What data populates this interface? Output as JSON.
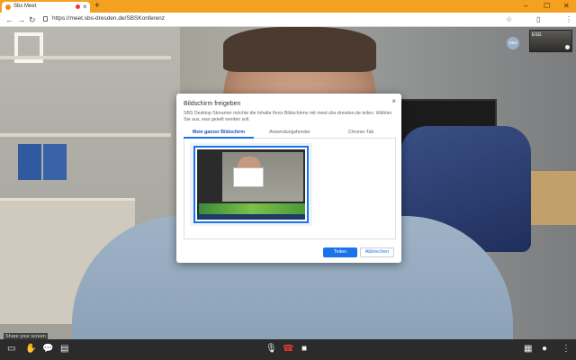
{
  "browser": {
    "tab_title": "Sbs Meet",
    "tab_close": "×",
    "new_tab": "+",
    "url": "https://meet.sbs-dresden.de/SBSKonferenz",
    "win_min": "–",
    "win_max": "☐",
    "win_close": "✕",
    "back": "←",
    "forward": "→",
    "reload": "↻",
    "star": "☆",
    "extensions": "⋮"
  },
  "meeting": {
    "self_label": "ESG",
    "avatar_initials": "SBS"
  },
  "dialog": {
    "title": "Bildschirm freigeben",
    "close": "×",
    "description": "SBS Desktop Streamer möchte die Inhalte Ihres Bildschirms mit meet.sbs-dresden.de teilen. Wählen Sie aus, was geteilt werden soll.",
    "tabs": [
      {
        "label": "Mein ganzer Bildschirm"
      },
      {
        "label": "Anwendungsfenster"
      },
      {
        "label": "Chrome-Tab"
      }
    ],
    "share_label": "Teilen",
    "cancel_label": "Abbrechen"
  },
  "controls": {
    "tooltip": "Share your screen",
    "screen_share": "▭",
    "raise_hand": "✋",
    "chat": "💬",
    "more_left": "▤",
    "mic": "🎙",
    "hangup": "☎",
    "camera": "■",
    "tile_view": "▦",
    "info": "●",
    "menu": "⋮"
  }
}
